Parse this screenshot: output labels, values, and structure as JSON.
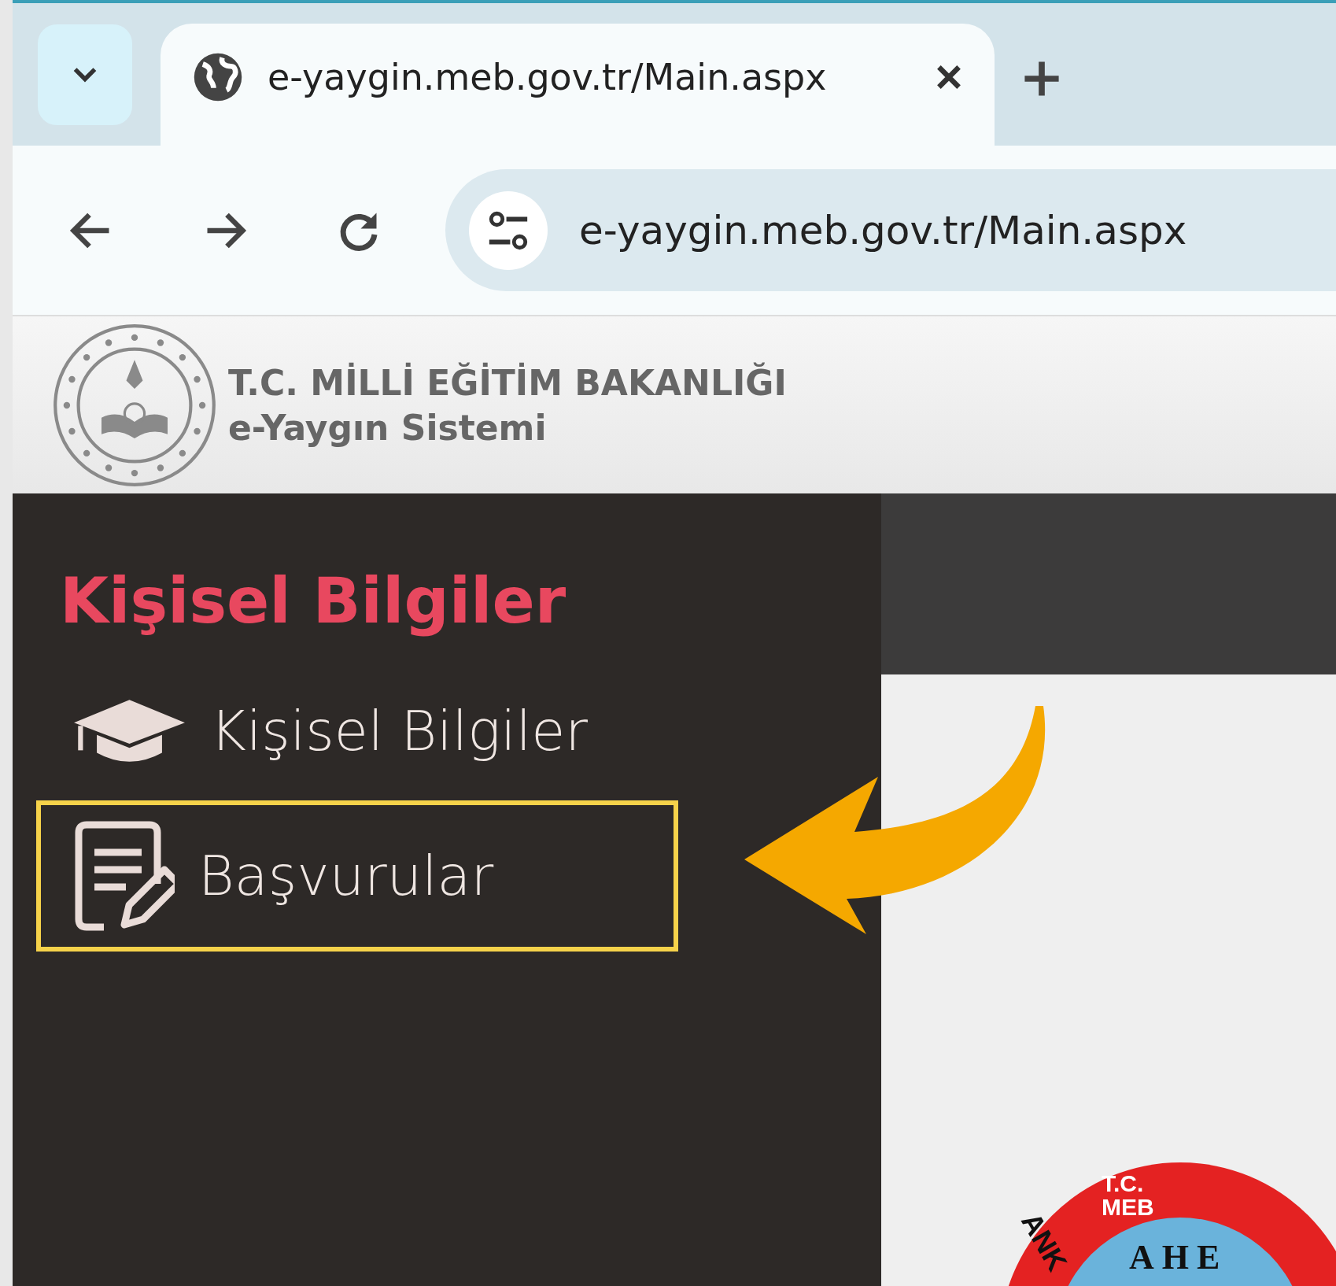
{
  "browser": {
    "tabs": [
      {
        "title": "e-yaygin.meb.gov.tr/Main.aspx",
        "selected": true
      }
    ],
    "address": "e-yaygin.meb.gov.tr/Main.aspx"
  },
  "site_header": {
    "title": "T.C. MİLLİ EĞİTİM BAKANLIĞI",
    "subtitle": "e-Yaygın Sistemi"
  },
  "sidebar": {
    "heading": "Kişisel Bilgiler",
    "items": [
      {
        "label": "Kişisel Bilgiler",
        "kind": "cap",
        "highlighted": false
      },
      {
        "label": "Başvurular",
        "kind": "form",
        "highlighted": true
      }
    ]
  },
  "content": {
    "emblem": {
      "top_text": "T.C.",
      "top_text_2": "MEB",
      "ring_text": "ANK",
      "center_text": "AHE"
    }
  }
}
